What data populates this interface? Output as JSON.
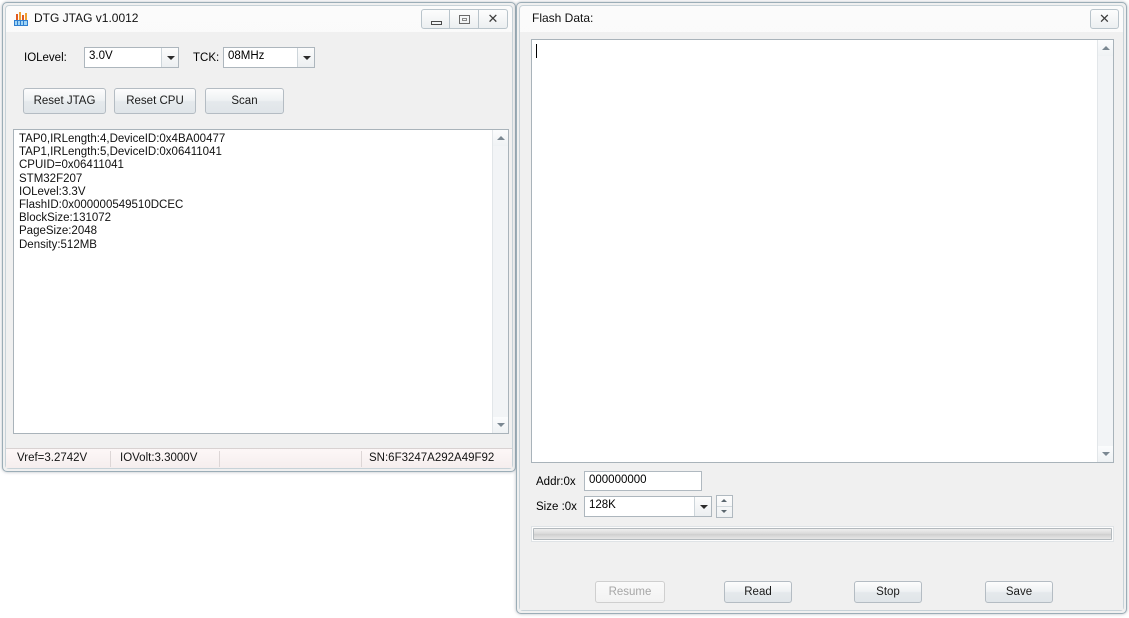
{
  "desktop": {
    "background": "#ffffff"
  },
  "left_window": {
    "title": "DTG JTAG v1.0012",
    "icon": "app-icon",
    "window_buttons": {
      "minimize": "minimize-icon",
      "maximize": "maximize-icon",
      "close": "✕"
    },
    "controls": {
      "iolevel_label": "IOLevel:",
      "iolevel_value": "3.0V",
      "tck_label": "TCK:",
      "tck_value": "08MHz",
      "reset_jtag_label": "Reset JTAG",
      "reset_cpu_label": "Reset CPU",
      "scan_label": "Scan"
    },
    "log": {
      "lines": [
        "TAP0,IRLength:4,DeviceID:0x4BA00477",
        "TAP1,IRLength:5,DeviceID:0x06411041",
        "CPUID=0x06411041",
        "STM32F207",
        "IOLevel:3.3V",
        "FlashID:0x000000549510DCEC",
        "BlockSize:131072",
        "PageSize:2048",
        "Density:512MB"
      ],
      "text": "TAP0,IRLength:4,DeviceID:0x4BA00477\nTAP1,IRLength:5,DeviceID:0x06411041\nCPUID=0x06411041\nSTM32F207\nIOLevel:3.3V\nFlashID:0x000000549510DCEC\nBlockSize:131072\nPageSize:2048\nDensity:512MB"
    },
    "statusbar": {
      "vref": "Vref=3.2742V",
      "iovolt": "IOVolt:3.3000V",
      "sn": "SN:6F3247A292A49F92"
    }
  },
  "right_window": {
    "title": "Flash Data:",
    "window_buttons": {
      "close": "✕"
    },
    "flash_data_value": "",
    "addr_label": "Addr:0x",
    "addr_value": "000000000",
    "size_label": "Size :0x",
    "size_value": "128K",
    "progress_percent": 0,
    "buttons": {
      "resume": "Resume",
      "read": "Read",
      "stop": "Stop",
      "save": "Save"
    }
  }
}
